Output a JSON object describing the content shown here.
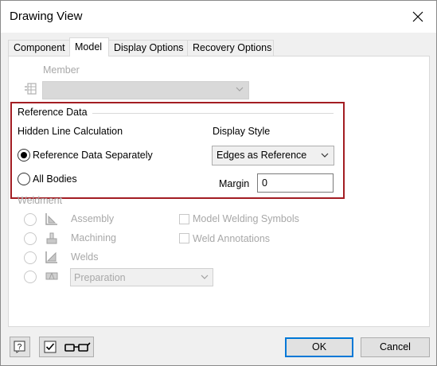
{
  "window": {
    "title": "Drawing View"
  },
  "tabs": [
    {
      "label": "Component",
      "active": false
    },
    {
      "label": "Model",
      "active": true
    },
    {
      "label": "Display Options",
      "active": false
    },
    {
      "label": "Recovery Options",
      "active": false
    }
  ],
  "member": {
    "label": "Member",
    "value": ""
  },
  "reference_data": {
    "group_label": "Reference Data",
    "hidden_line_label": "Hidden Line Calculation",
    "options": [
      {
        "label": "Reference Data Separately",
        "checked": true
      },
      {
        "label": "All Bodies",
        "checked": false
      }
    ],
    "display_style_label": "Display Style",
    "display_style_value": "Edges as Reference",
    "margin_label": "Margin",
    "margin_value": "0"
  },
  "weldment": {
    "group_label": "Weldment",
    "items": [
      {
        "label": "Assembly",
        "icon": "assembly-icon"
      },
      {
        "label": "Machining",
        "icon": "machining-icon"
      },
      {
        "label": "Welds",
        "icon": "welds-icon"
      }
    ],
    "preparation_value": "Preparation",
    "checkboxes": [
      {
        "label": "Model Welding Symbols",
        "checked": false
      },
      {
        "label": "Weld Annotations",
        "checked": false
      }
    ]
  },
  "footer": {
    "ok_label": "OK",
    "cancel_label": "Cancel",
    "show_preview_checked": true
  },
  "colors": {
    "highlight_border": "#a31d23",
    "ok_border": "#0078d7",
    "disabled_text": "#a8a8a8"
  }
}
